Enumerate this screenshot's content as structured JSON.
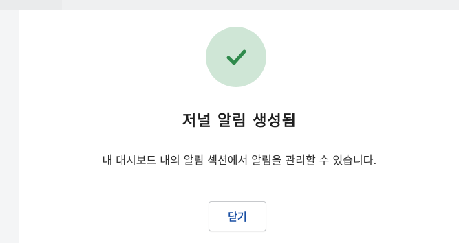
{
  "dialog": {
    "icon": "check-icon",
    "title": "저널 알림 생성됨",
    "message": "내 대시보드 내의 알림 섹션에서 알림을 관리할 수 있습니다.",
    "close_label": "닫기"
  },
  "colors": {
    "success_circle": "#cfe6d6",
    "check_mark": "#2f8a4c",
    "button_text": "#1a4fa3",
    "title_text": "#1f1f1f"
  }
}
